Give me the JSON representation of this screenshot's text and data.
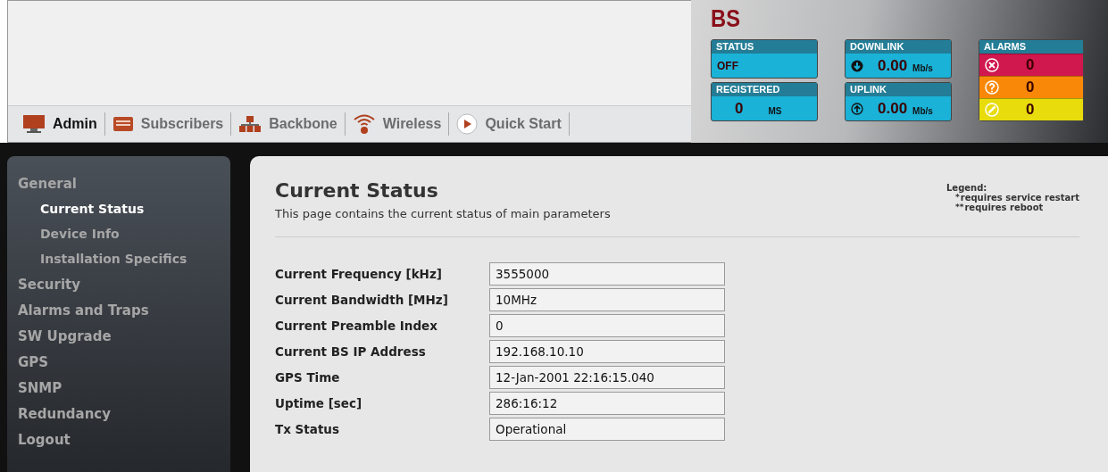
{
  "header": {
    "tabs": [
      {
        "label": "Admin",
        "kind": "monitor",
        "selected": true
      },
      {
        "label": "Subscribers",
        "kind": "folder",
        "selected": false
      },
      {
        "label": "Backbone",
        "kind": "network",
        "selected": false
      },
      {
        "label": "Wireless",
        "kind": "wifi",
        "selected": false
      },
      {
        "label": "Quick Start",
        "kind": "play",
        "selected": false
      }
    ],
    "device": {
      "title": "BS",
      "status": {
        "label": "STATUS",
        "value": "OFF"
      },
      "registered": {
        "label": "REGISTERED",
        "value": "0",
        "unit": "MS"
      },
      "downlink": {
        "label": "DOWNLINK",
        "value": "0.00",
        "unit": "Mb/s"
      },
      "uplink": {
        "label": "UPLINK",
        "value": "0.00",
        "unit": "Mb/s"
      },
      "alarms": {
        "label": "ALARMS",
        "rows": [
          {
            "kind": "critical",
            "color": "#d0174e",
            "count": "0"
          },
          {
            "kind": "major",
            "color": "#f98808",
            "count": "0"
          },
          {
            "kind": "minor",
            "color": "#e8dc0c",
            "count": "0"
          }
        ]
      }
    }
  },
  "sidebar": {
    "items": [
      {
        "label": "General",
        "selected": false,
        "children": [
          {
            "label": "Current Status",
            "selected": true
          },
          {
            "label": "Device Info",
            "selected": false
          },
          {
            "label": "Installation Specifics",
            "selected": false
          }
        ]
      },
      {
        "label": "Security",
        "selected": false
      },
      {
        "label": "Alarms and Traps",
        "selected": false
      },
      {
        "label": "SW Upgrade",
        "selected": false
      },
      {
        "label": "GPS",
        "selected": false
      },
      {
        "label": "SNMP",
        "selected": false
      },
      {
        "label": "Redundancy",
        "selected": false
      },
      {
        "label": "Logout",
        "selected": false
      }
    ]
  },
  "content": {
    "title": "Current Status",
    "description": "This page contains the current status of main parameters",
    "legend": {
      "title": "Legend:",
      "entries": [
        {
          "mark": "*",
          "text": "requires service restart"
        },
        {
          "mark": "**",
          "text": "requires reboot"
        }
      ]
    },
    "fields": [
      {
        "label": "Current Frequency [kHz]",
        "value": "3555000"
      },
      {
        "label": "Current Bandwidth [MHz]",
        "value": "10MHz"
      },
      {
        "label": "Current Preamble Index",
        "value": "0"
      },
      {
        "label": "Current BS IP Address",
        "value": "192.168.10.10"
      },
      {
        "label": "GPS Time",
        "value": "12-Jan-2001 22:16:15.040"
      },
      {
        "label": "Uptime [sec]",
        "value": "286:16:12"
      },
      {
        "label": "Tx Status",
        "value": "Operational"
      }
    ]
  }
}
